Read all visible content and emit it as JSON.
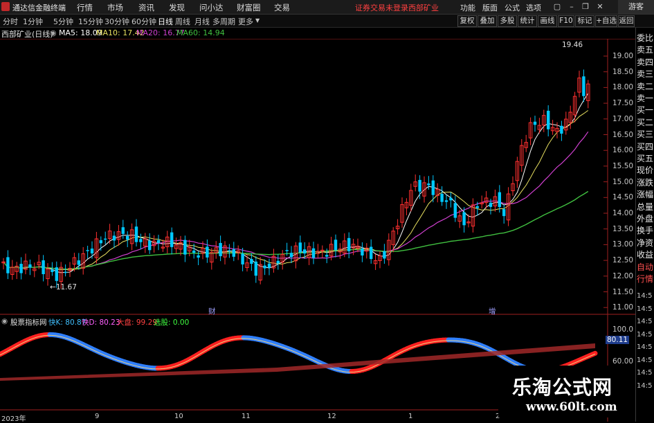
{
  "menubar": {
    "app_title": "通达信金融终端",
    "items": [
      "行情",
      "市场",
      "资讯",
      "发现",
      "问小达",
      "财富圈",
      "交易"
    ],
    "notice": "证券交易未登录",
    "stock": "西部矿业",
    "right_items": [
      "功能",
      "版面",
      "公式",
      "选项"
    ],
    "guest": "游客"
  },
  "periodbar": {
    "periods": [
      "分时",
      "1分钟",
      "5分钟",
      "15分钟",
      "30分钟",
      "60分钟",
      "日线",
      "周线",
      "月线",
      "多周期",
      "更多"
    ],
    "active": "日线",
    "buttons": [
      "复权",
      "叠加",
      "多股",
      "统计",
      "画线",
      "F10",
      "标记",
      "+自选",
      "返回"
    ]
  },
  "infoline": {
    "title": "西部矿业(日线)",
    "ma5": "MA5: 18.09",
    "ma10": "MA10: 17.42",
    "ma20": "MA20: 16.77",
    "ma60": "MA60: 14.94"
  },
  "price_axis": [
    "19.00",
    "18.50",
    "18.00",
    "17.50",
    "17.00",
    "16.50",
    "16.00",
    "15.50",
    "15.00",
    "14.50",
    "14.00",
    "13.50",
    "13.00",
    "12.50",
    "12.00",
    "11.50",
    "11.00"
  ],
  "annotations": {
    "high": "19.46",
    "low": "11.67",
    "marker_cai": "财",
    "marker_zeng": "增"
  },
  "indicator": {
    "name": "股票指标网",
    "fast_k": "快K: 80.87",
    "fast_d": "快D: 80.23",
    "market": "大盘: 99.29",
    "pick": "选股: 0.00",
    "axis": [
      "100.0",
      "80.11",
      "60.00"
    ]
  },
  "date_axis": [
    "2023年",
    "9",
    "10",
    "11",
    "12",
    "1",
    "2"
  ],
  "right_panel": {
    "items": [
      "委比",
      "卖五",
      "卖四",
      "卖三",
      "卖二",
      "卖一",
      "买一",
      "买二",
      "买三",
      "买四",
      "买五",
      "现价",
      "涨跌",
      "涨幅",
      "总量",
      "外盘",
      "换手",
      "净资",
      "收益",
      "自动",
      "行情"
    ],
    "numbers": [
      "14:5",
      "14:5",
      "14:5",
      "14:5",
      "14:5",
      "14:5",
      "14:5",
      "14:5"
    ]
  },
  "watermark": {
    "line1": "乐淘公式网",
    "line2": "www.60lt.com"
  },
  "colors": {
    "up": "#ff3030",
    "down": "#00c8ff",
    "ma5": "#ffffff",
    "ma10": "#e8e060",
    "ma20": "#d040d0",
    "ma60": "#40c040"
  }
}
